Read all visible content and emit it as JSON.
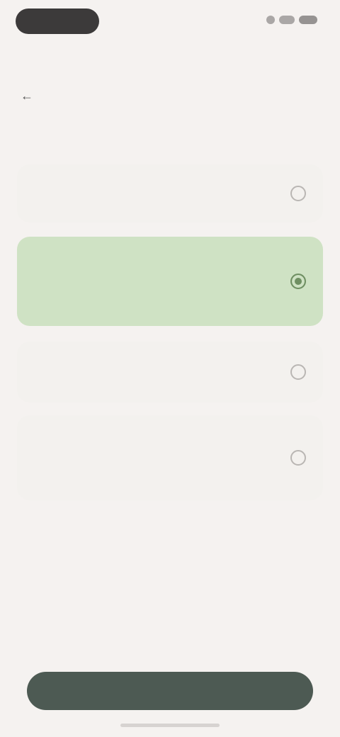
{
  "status_bar": {
    "left_icon": "status-pill",
    "right_icons": [
      "signal-icon",
      "wifi-icon",
      "battery-icon"
    ]
  },
  "header": {
    "back_icon": "arrow-left-icon",
    "title": ""
  },
  "options": [
    {
      "title": "",
      "subtitle": "",
      "selected": false
    },
    {
      "title": "",
      "subtitle": "",
      "selected": true
    },
    {
      "title": "",
      "subtitle": "",
      "selected": false
    },
    {
      "title": "",
      "subtitle": "",
      "selected": false
    }
  ],
  "info": {
    "heading": "",
    "body": ""
  },
  "footer": {
    "button_label": ""
  },
  "colors": {
    "background": "#f5f2f0",
    "selected_option": "#cfe2c4",
    "button": "#4d5a53"
  }
}
